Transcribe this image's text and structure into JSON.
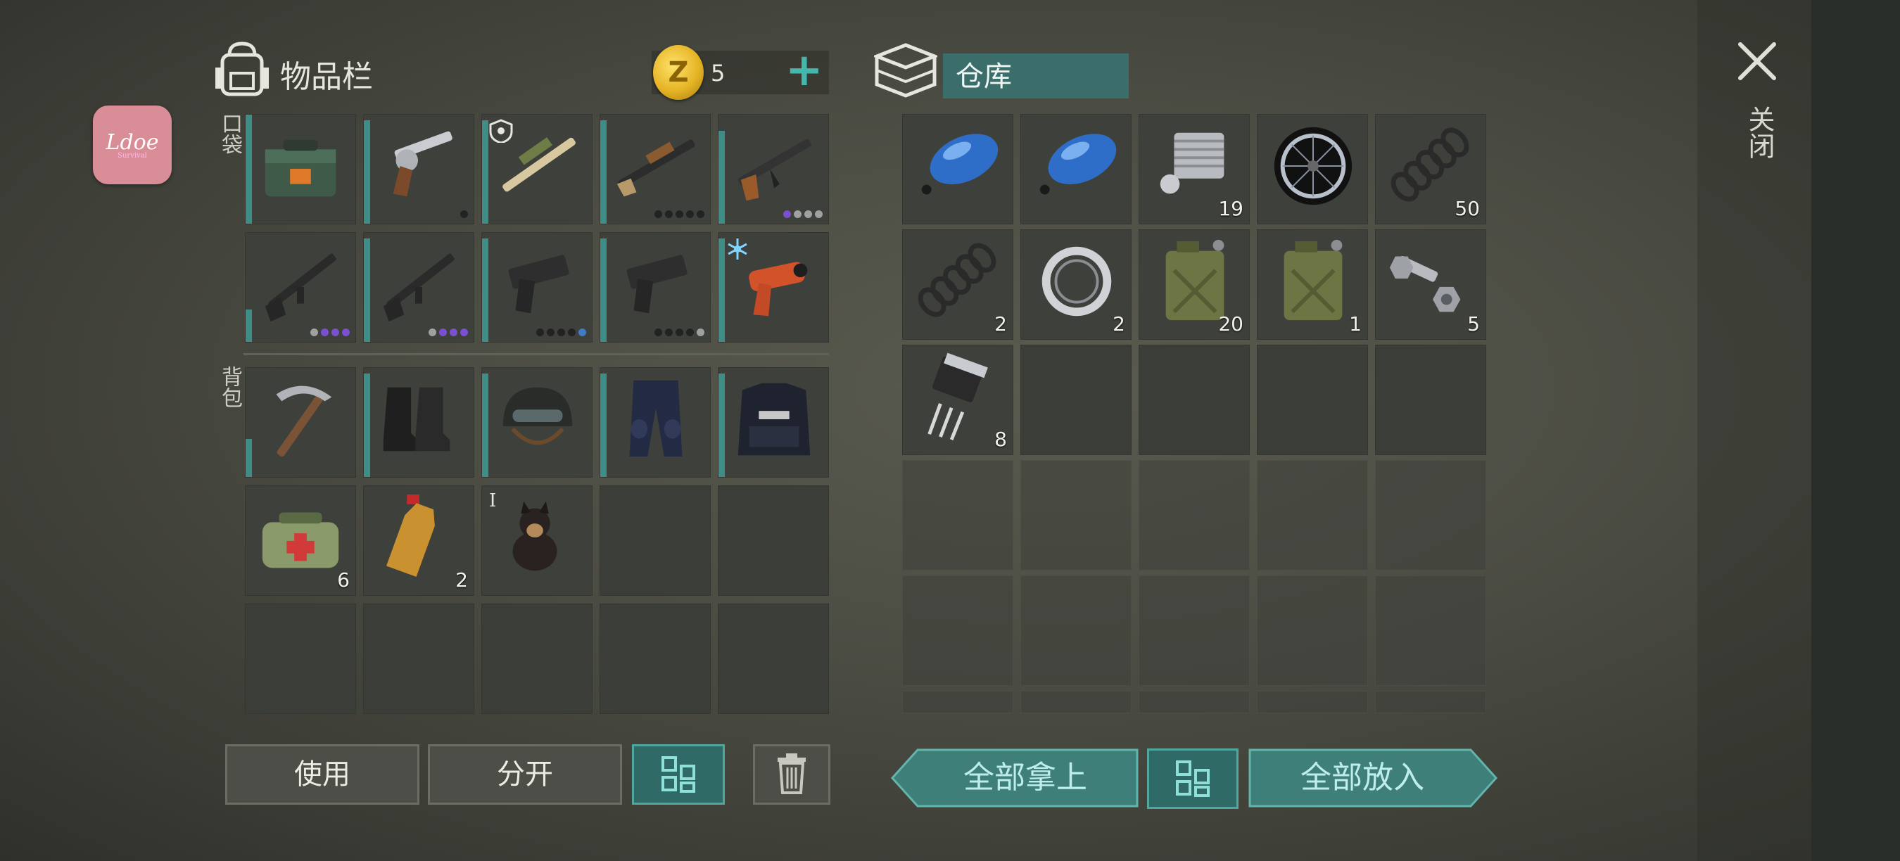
{
  "inventory": {
    "title": "物品栏",
    "coins": "5",
    "pocket_label": "口袋",
    "backpack_label": "背包",
    "pocket": [
      {
        "icon": "ammo-box-icon",
        "qty": "",
        "bar": 1.0,
        "dots": []
      },
      {
        "icon": "revolver-icon",
        "qty": "",
        "bar": 0.95,
        "dots": [
          "#222"
        ]
      },
      {
        "icon": "shotgun-icon",
        "qty": "",
        "bar": 0.95,
        "dots": [],
        "badge": "shield-badge-icon"
      },
      {
        "icon": "pump-shotgun-icon",
        "qty": "",
        "bar": 0.95,
        "dots": [
          "#222",
          "#222",
          "#222",
          "#222",
          "#222"
        ]
      },
      {
        "icon": "ak47-icon",
        "qty": "",
        "bar": 0.85,
        "dots": [
          "#7a4fd0",
          "#a0a0a0",
          "#a0a0a0",
          "#a0a0a0"
        ]
      },
      {
        "icon": "m16-rifle-icon",
        "qty": "",
        "bar": 0.3,
        "dots": [
          "#a0a0a0",
          "#7a4fd0",
          "#7a4fd0",
          "#7a4fd0"
        ]
      },
      {
        "icon": "m16-rifle-icon",
        "qty": "",
        "bar": 0.95,
        "dots": [
          "#a0a0a0",
          "#7a4fd0",
          "#7a4fd0",
          "#7a4fd0"
        ]
      },
      {
        "icon": "pistol-icon",
        "qty": "",
        "bar": 0.95,
        "dots": [
          "#222",
          "#222",
          "#222",
          "#222",
          "#3f7cc4"
        ]
      },
      {
        "icon": "pistol-icon",
        "qty": "",
        "bar": 0.95,
        "dots": [
          "#222",
          "#222",
          "#222",
          "#222",
          "#a0a0a0"
        ]
      },
      {
        "icon": "flare-gun-icon",
        "qty": "",
        "bar": 0.95,
        "dots": [],
        "badge": "frost-badge-icon"
      }
    ],
    "backpack": [
      {
        "icon": "pickaxe-icon",
        "qty": "",
        "bar": 0.35
      },
      {
        "icon": "boots-icon",
        "qty": "",
        "bar": 0.95
      },
      {
        "icon": "helmet-icon",
        "qty": "",
        "bar": 0.95
      },
      {
        "icon": "armored-pants-icon",
        "qty": "",
        "bar": 0.95
      },
      {
        "icon": "police-vest-icon",
        "qty": "",
        "bar": 0.95
      },
      {
        "icon": "medical-bag-icon",
        "qty": "6",
        "bar": 0
      },
      {
        "icon": "water-bottle-icon",
        "qty": "2",
        "bar": 0
      },
      {
        "icon": "dog-icon",
        "qty": "",
        "bar": 0,
        "tier": "I"
      },
      {
        "icon": "",
        "qty": "",
        "bar": 0
      },
      {
        "icon": "",
        "qty": "",
        "bar": 0
      },
      {
        "icon": "",
        "qty": "",
        "bar": 0
      },
      {
        "icon": "",
        "qty": "",
        "bar": 0
      },
      {
        "icon": "",
        "qty": "",
        "bar": 0
      },
      {
        "icon": "",
        "qty": "",
        "bar": 0
      },
      {
        "icon": "",
        "qty": "",
        "bar": 0
      }
    ],
    "buttons": {
      "use": "使用",
      "split": "分开"
    }
  },
  "warehouse": {
    "title": "仓库",
    "items": [
      {
        "icon": "fuel-tank-icon",
        "qty": ""
      },
      {
        "icon": "fuel-tank-icon",
        "qty": ""
      },
      {
        "icon": "engine-cylinder-icon",
        "qty": "19"
      },
      {
        "icon": "wheel-icon",
        "qty": ""
      },
      {
        "icon": "spring-icon",
        "qty": "50"
      },
      {
        "icon": "spring-icon",
        "qty": "2"
      },
      {
        "icon": "bearing-icon",
        "qty": "2"
      },
      {
        "icon": "jerry-can-icon",
        "qty": "20"
      },
      {
        "icon": "jerry-can-icon",
        "qty": "1"
      },
      {
        "icon": "bolt-nut-icon",
        "qty": "5"
      },
      {
        "icon": "transistor-icon",
        "qty": "8"
      }
    ],
    "take_all": "全部拿上",
    "put_all": "全部放入"
  },
  "close_label": "关闭",
  "logo_text": "Ldoe"
}
